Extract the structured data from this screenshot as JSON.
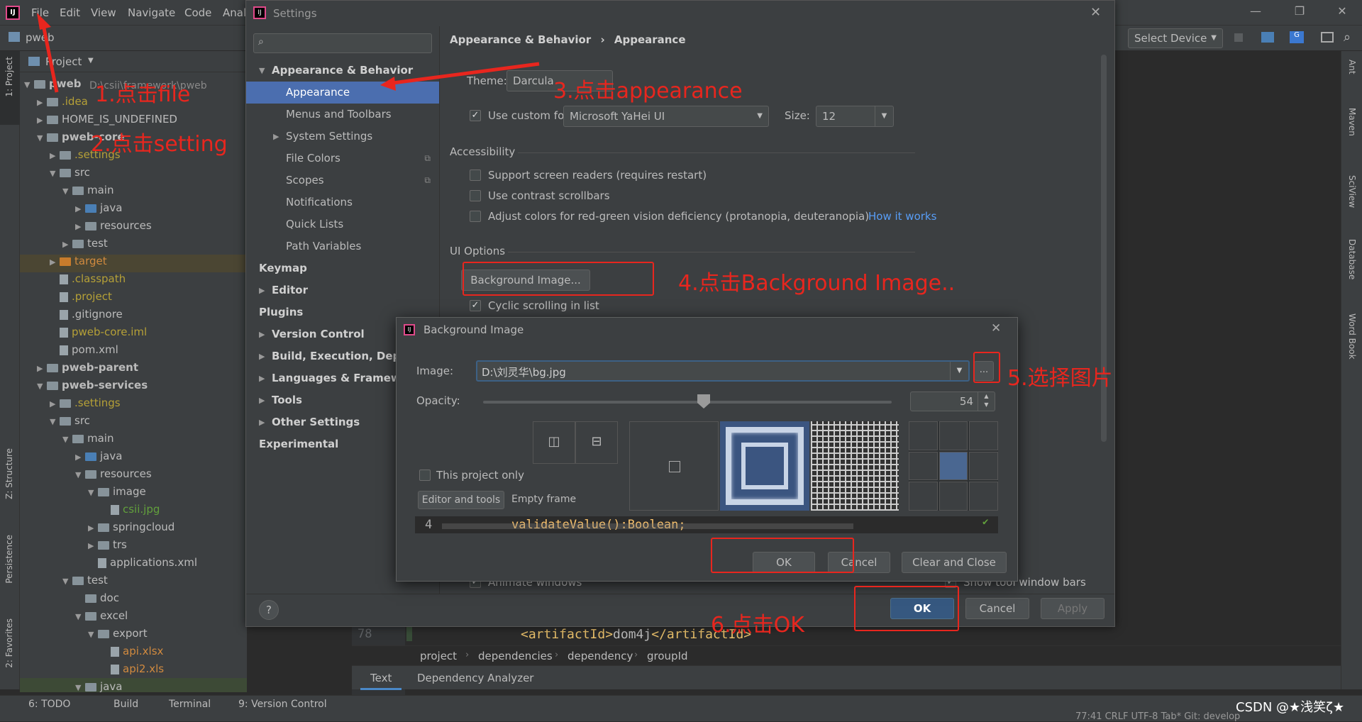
{
  "menubar": {
    "items": [
      "File",
      "Edit",
      "View",
      "Navigate",
      "Code",
      "Anal"
    ],
    "settings_title": "Settings",
    "window_controls": [
      "minimize-icon",
      "restore-icon",
      "close-icon"
    ]
  },
  "toolbar": {
    "project_crumb": "pweb",
    "select_device": "Select Device"
  },
  "left_tabs": [
    "1: Project",
    "Z: Structure",
    "Persistence",
    "2: Favorites"
  ],
  "right_tabs": [
    "Ant",
    "Maven",
    "SciView",
    "Database",
    "Word Book"
  ],
  "project_panel": {
    "header": "Project",
    "root_path": "D:\\csii\\framework\\pweb",
    "tree": [
      {
        "label": "pweb",
        "bold": true
      },
      {
        "label": ".idea",
        "color": "yellow"
      },
      {
        "label": "HOME_IS_UNDEFINED"
      },
      {
        "label": "pweb-core",
        "bold": true
      },
      {
        "label": ".settings",
        "color": "yellow"
      },
      {
        "label": "src"
      },
      {
        "label": "main"
      },
      {
        "label": "java"
      },
      {
        "label": "resources"
      },
      {
        "label": "test"
      },
      {
        "label": "target",
        "color": "orange"
      },
      {
        "label": ".classpath",
        "color": "yellow"
      },
      {
        "label": ".project",
        "color": "yellow"
      },
      {
        "label": ".gitignore"
      },
      {
        "label": "pweb-core.iml",
        "color": "yellow"
      },
      {
        "label": "pom.xml"
      },
      {
        "label": "pweb-parent",
        "bold": true
      },
      {
        "label": "pweb-services",
        "bold": true
      },
      {
        "label": ".settings",
        "color": "yellow"
      },
      {
        "label": "src"
      },
      {
        "label": "main"
      },
      {
        "label": "java"
      },
      {
        "label": "resources"
      },
      {
        "label": "image"
      },
      {
        "label": "csii.jpg",
        "color": "green"
      },
      {
        "label": "springcloud"
      },
      {
        "label": "trs"
      },
      {
        "label": "applications.xml"
      },
      {
        "label": "test"
      },
      {
        "label": "doc"
      },
      {
        "label": "excel"
      },
      {
        "label": "export"
      },
      {
        "label": "api.xlsx",
        "color": "orange"
      },
      {
        "label": "api2.xls",
        "color": "orange"
      },
      {
        "label": "java"
      }
    ]
  },
  "settings": {
    "search_placeholder": "",
    "breadcrumb": [
      "Appearance & Behavior",
      "Appearance"
    ],
    "sidebar": [
      {
        "label": "Appearance & Behavior",
        "bold": true,
        "expanded": true
      },
      {
        "label": "Appearance",
        "selected": true
      },
      {
        "label": "Menus and Toolbars"
      },
      {
        "label": "System Settings"
      },
      {
        "label": "File Colors"
      },
      {
        "label": "Scopes"
      },
      {
        "label": "Notifications"
      },
      {
        "label": "Quick Lists"
      },
      {
        "label": "Path Variables"
      },
      {
        "label": "Keymap",
        "bold": true
      },
      {
        "label": "Editor",
        "bold": true
      },
      {
        "label": "Plugins",
        "bold": true
      },
      {
        "label": "Version Control",
        "bold": true
      },
      {
        "label": "Build, Execution, Deploy",
        "bold": true
      },
      {
        "label": "Languages & Framewo",
        "bold": true
      },
      {
        "label": "Tools",
        "bold": true
      },
      {
        "label": "Other Settings",
        "bold": true
      },
      {
        "label": "Experimental",
        "bold": true
      }
    ],
    "theme_label": "Theme:",
    "theme_value": "Darcula",
    "custom_font_label": "Use custom font:",
    "custom_font_value": "Microsoft YaHei UI",
    "size_label": "Size:",
    "size_value": "12",
    "accessibility_title": "Accessibility",
    "acc_options": [
      "Support screen readers (requires restart)",
      "Use contrast scrollbars",
      "Adjust colors for red-green vision deficiency (protanopia, deuteranopia)"
    ],
    "how_it_works": "How it works",
    "ui_options_title": "UI Options",
    "background_image_btn": "Background Image...",
    "cyclic_scrolling": "Cyclic scrolling in list",
    "animate_windows": "Animate windows",
    "show_tool_window_bars": "Show tool window bars",
    "ok": "OK",
    "cancel": "Cancel",
    "apply": "Apply",
    "help": "?"
  },
  "bg_dialog": {
    "title": "Background Image",
    "image_label": "Image:",
    "image_value": "D:\\刘灵华\\bg.jpg",
    "browse": "...",
    "opacity_label": "Opacity:",
    "opacity_value": "54",
    "opacity_fraction": 0.54,
    "this_project_only": "This project only",
    "tab_editor_tools": "Editor and tools",
    "tab_empty_frame": "Empty frame",
    "preview_line_no": "4",
    "preview_code": "validateValue():Boolean;",
    "ok": "OK",
    "cancel": "Cancel",
    "clear_close": "Clear and Close"
  },
  "editor": {
    "line_no": "78",
    "code_open": "<artifactId>",
    "code_value": "dom4j",
    "code_close": "</artifactId>",
    "breadcrumb": [
      "project",
      "dependencies",
      "dependency",
      "groupId"
    ],
    "tabs": [
      "Text",
      "Dependency Analyzer"
    ]
  },
  "statusbar": {
    "items": [
      "6: TODO",
      "Build",
      "Terminal",
      "9: Version Control"
    ],
    "right": "77:41   CRLF   UTF-8   Tab*   Git: develop",
    "watermark": "CSDN @★浅笑ζ★"
  },
  "annotations": {
    "step1": "1.点击file",
    "step2": "2.点击setting",
    "step3": "3.点击appearance",
    "step4": "4.点击Background Image..",
    "step5": "5.选择图片",
    "step6": "6.点击OK"
  },
  "colors": {
    "accent": "#4b6eaf",
    "annotation": "#e8261e",
    "link": "#589df6"
  }
}
